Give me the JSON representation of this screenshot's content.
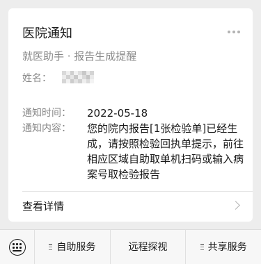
{
  "card": {
    "title": "医院通知",
    "subtitle": "就医助手 · 报告生成提醒",
    "name_label": "姓名：",
    "name_value": "",
    "time_label": "通知时间：",
    "time_value": "2022-05-18",
    "content_label": "通知内容：",
    "content_value": "您的院内报告[1张检验单]已经生成，请按照检验回执单提示，前往相应区域自助取单机扫码或输入病案号取检验报告",
    "detail_label": "查看详情"
  },
  "bottom_bar": {
    "items": [
      {
        "label": "自助服务",
        "has_menu": true
      },
      {
        "label": "远程探视",
        "has_menu": false
      },
      {
        "label": "共享服务",
        "has_menu": true
      }
    ]
  }
}
